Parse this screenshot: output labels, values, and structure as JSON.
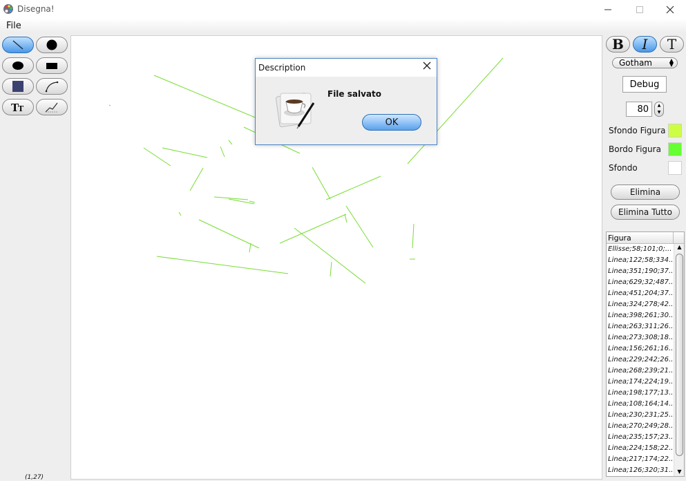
{
  "window": {
    "title": "Disegna!",
    "minimize_icon": "minimize-icon",
    "maximize_icon": "maximize-icon",
    "close_icon": "close-icon"
  },
  "menu": {
    "file": "File"
  },
  "toolbox": {
    "tools": [
      {
        "name": "line-tool",
        "icon": "line-icon",
        "selected": true
      },
      {
        "name": "filled-circle-tool",
        "icon": "filled-circle-icon",
        "selected": false
      },
      {
        "name": "ellipse-tool",
        "icon": "ellipse-icon",
        "selected": false
      },
      {
        "name": "rectangle-tool",
        "icon": "rectangle-icon",
        "selected": false
      },
      {
        "name": "square-tool",
        "icon": "square-icon",
        "selected": false
      },
      {
        "name": "curve-tool",
        "icon": "curve-icon",
        "selected": false
      },
      {
        "name": "text-tool",
        "icon": "text-tool-icon",
        "selected": false
      },
      {
        "name": "polyline-tool",
        "icon": "polyline-icon",
        "selected": false
      }
    ],
    "coords": "(1,27)"
  },
  "format": {
    "bold": "B",
    "italic": "I",
    "text": "T",
    "italic_selected": true,
    "font": "Gotham",
    "sample_text": "Debug",
    "size": "80"
  },
  "colors": {
    "fill_label": "Sfondo Figura",
    "fill_color": "#ccff44",
    "border_label": "Bordo Figura",
    "border_color": "#66ff33",
    "background_label": "Sfondo",
    "background_color": "#ffffff",
    "line_color": "#77dd33"
  },
  "actions": {
    "delete": "Elimina",
    "delete_all": "Elimina Tutto"
  },
  "figure_list": {
    "header": "Figura",
    "rows": [
      "Ellisse;58;101;0;...",
      "Linea;122;58;334...",
      "Linea;351;190;37...",
      "Linea;629;32;487...",
      "Linea;451;204;37...",
      "Linea;324;278;42...",
      "Linea;398;261;30...",
      "Linea;263;311;26...",
      "Linea;273;308;18...",
      "Linea;156;261;16...",
      "Linea;229;242;26...",
      "Linea;268;239;21...",
      "Linea;174;224;19...",
      "Linea;198;177;13...",
      "Linea;108;164;14...",
      "Linea;230;231;25...",
      "Linea;270;249;28...",
      "Linea;235;157;23...",
      "Linea;224;158;22...",
      "Linea;217;174;22...",
      "Linea;126;320;31..."
    ]
  },
  "dialog": {
    "title": "Description",
    "message": "File salvato",
    "ok": "OK",
    "icon": "coffee-cup-pen-icon"
  }
}
